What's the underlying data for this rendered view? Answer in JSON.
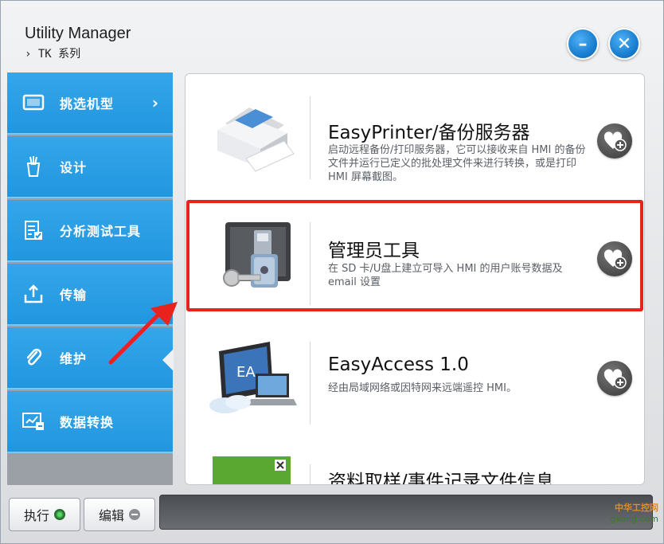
{
  "app": {
    "title": "Utility Manager",
    "subtitle": "› TK 系列"
  },
  "window_buttons": {
    "minimize": "–",
    "close": "✕"
  },
  "sidebar": {
    "items": [
      {
        "label": "挑选机型",
        "icon": "monitor-icon",
        "chevron": "›"
      },
      {
        "label": "设计",
        "icon": "design-tools-icon"
      },
      {
        "label": "分析测试工具",
        "icon": "checklist-icon"
      },
      {
        "label": "传输",
        "icon": "upload-icon"
      },
      {
        "label": "维护",
        "icon": "paperclip-icon",
        "selected": true
      },
      {
        "label": "数据转换",
        "icon": "data-convert-icon"
      }
    ]
  },
  "cards": [
    {
      "title": "EasyPrinter/备份服务器",
      "desc": "启动远程备份/打印服务器，它可以接收来自 HMI 的备份文件并运行已定义的批处理文件来进行转换，或是打印 HMI 屏幕截图。",
      "icon": "printer-icon"
    },
    {
      "title": "管理员工具",
      "desc": "在 SD 卡/U盘上建立可导入 HMI 的用户账号数据及 email 设置",
      "icon": "usb-key-lock-icon"
    },
    {
      "title": "EasyAccess 1.0",
      "desc": "经由局域网络或因特网来远端遥控 HMI。",
      "icon": "easyaccess-icon"
    },
    {
      "title": "资料取样/事件记录文件信息",
      "desc": "",
      "icon": "data-file-icon"
    }
  ],
  "bottom": {
    "run_label": "执行",
    "edit_label": "编辑"
  },
  "watermark": {
    "line1": "中华工控网",
    "line2": "gkong.com"
  },
  "colors": {
    "sidebar_blue": "#2196df",
    "highlight_red": "#e8231d",
    "window_button_blue": "#1a7fd1"
  }
}
